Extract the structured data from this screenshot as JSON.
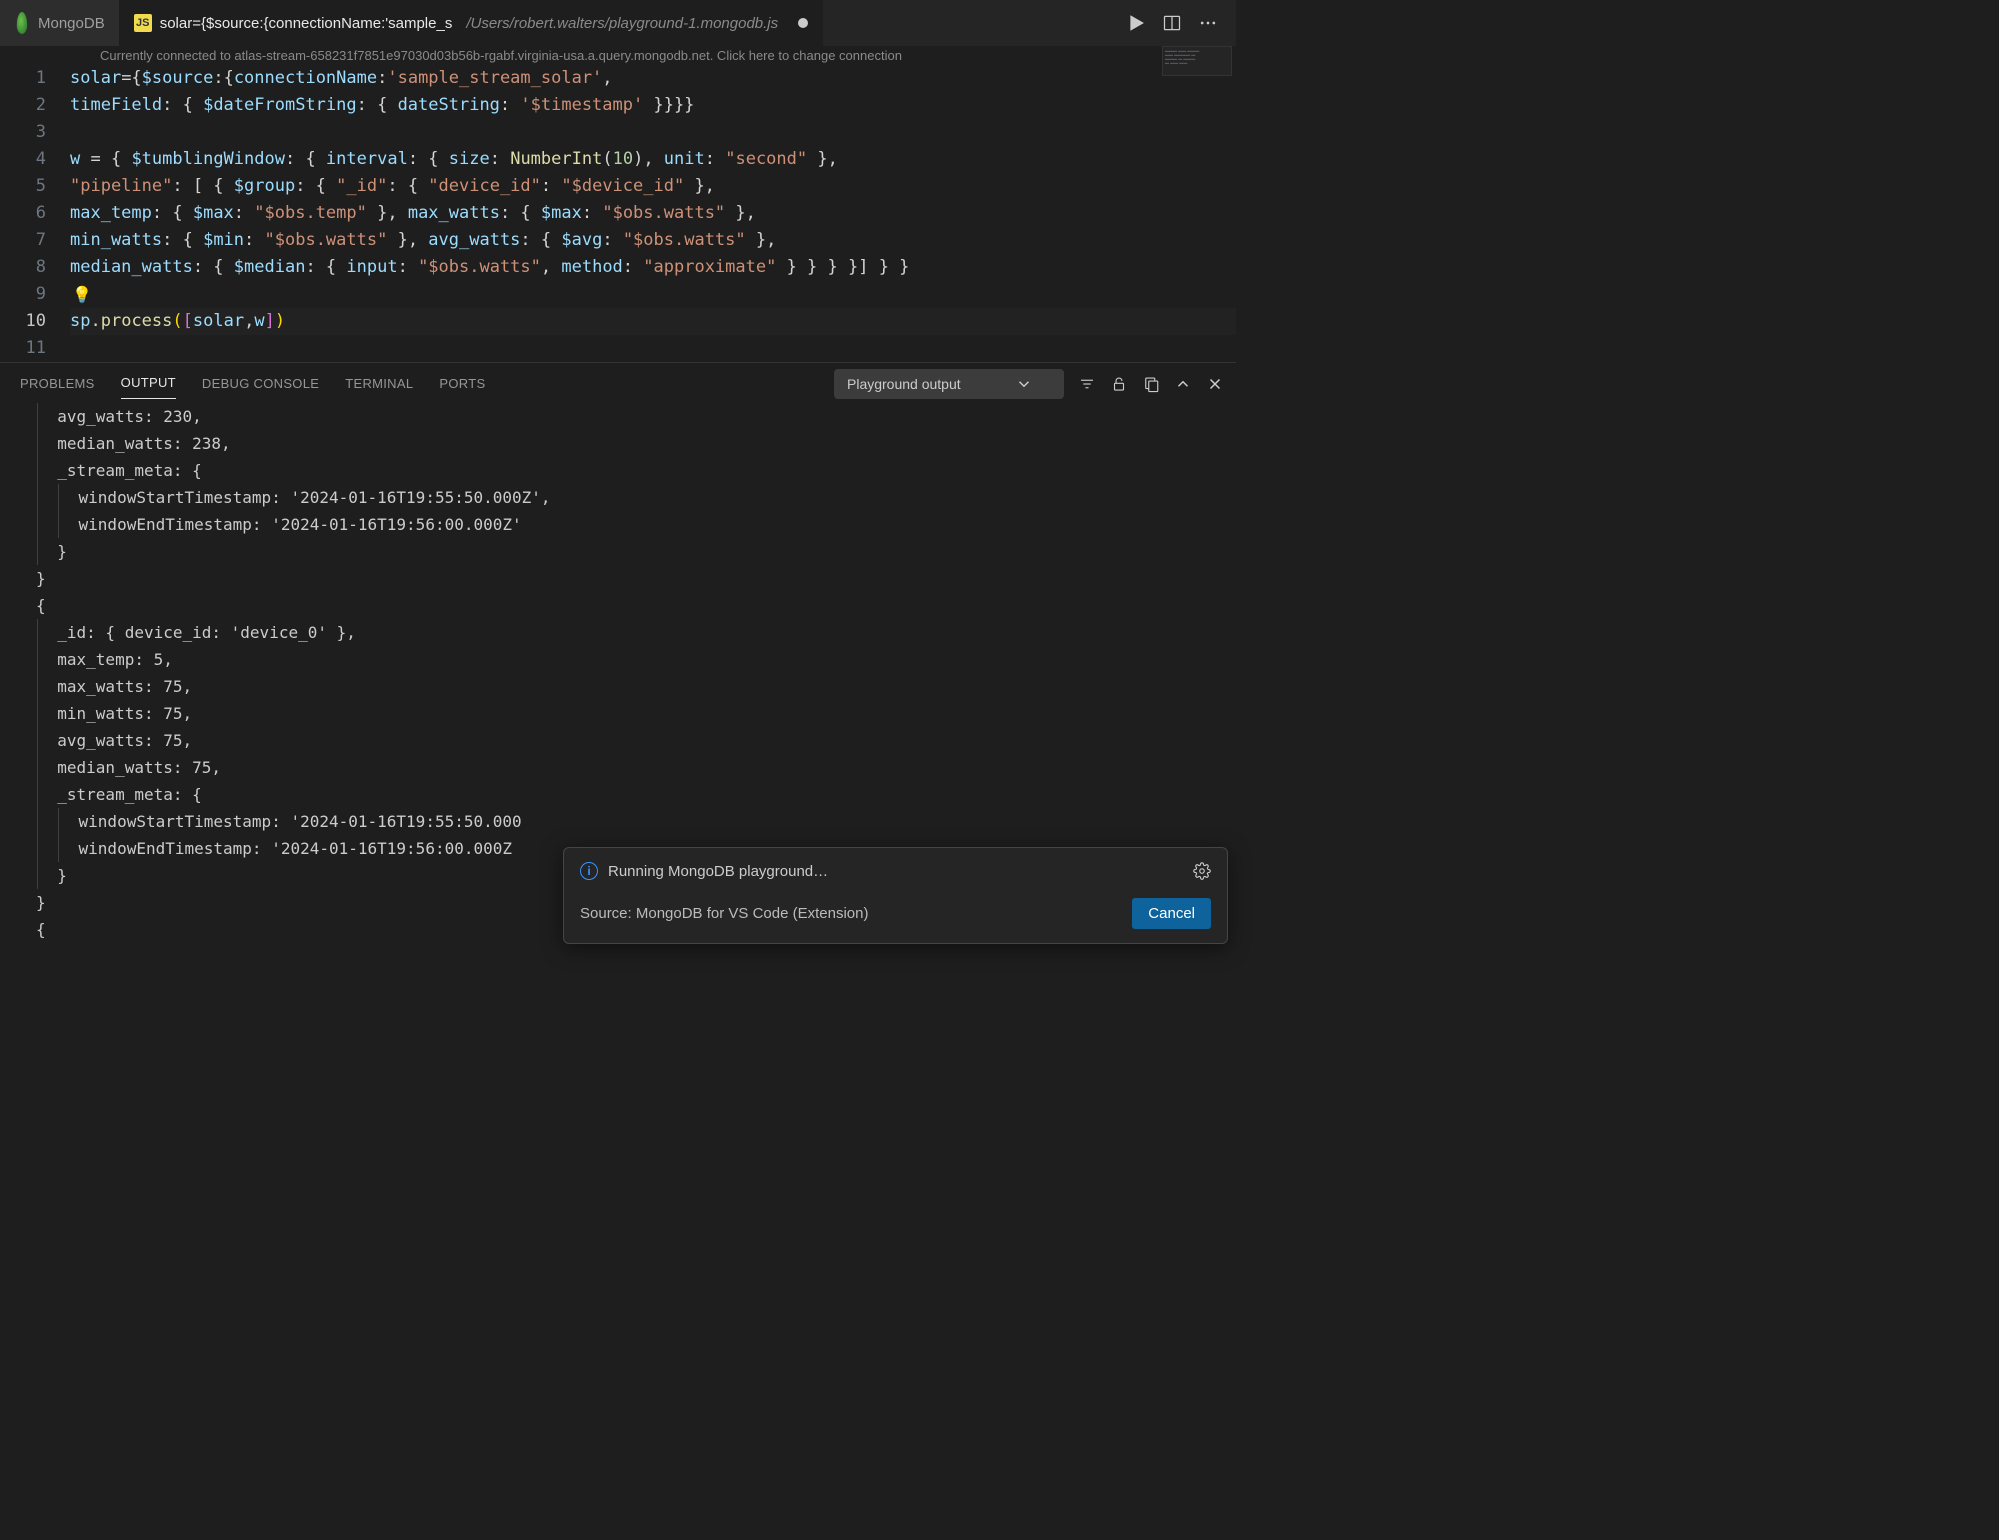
{
  "tabs": {
    "mongo_label": "MongoDB",
    "file_badge": "JS",
    "file_title": "solar={$source:{connectionName:'sample_s",
    "file_path": "/Users/robert.walters/playground-1.mongodb.js"
  },
  "connection_banner": "Currently connected to atlas-stream-658231f7851e97030d03b56b-rgabf.virginia-usa.a.query.mongodb.net. Click here to change connection",
  "editor": {
    "line_numbers": [
      "1",
      "2",
      "3",
      "4",
      "5",
      "6",
      "7",
      "8",
      "9",
      "10",
      "11"
    ],
    "lines": {
      "l1": {
        "pre": "solar",
        "mid": "={",
        "k1": "$source",
        "mid2": ":{",
        "k2": "connectionName",
        "mid3": ":",
        "s1": "'sample_stream_solar'",
        "end": ","
      },
      "l2": {
        "k1": "timeField",
        "mid": ": { ",
        "k2": "$dateFromString",
        "mid2": ": { ",
        "k3": "dateString",
        "mid3": ": ",
        "s1": "'$timestamp'",
        "end": " }}}}"
      },
      "l4": {
        "pre": "w ",
        "mid": "= { ",
        "k1": "$tumblingWindow",
        "mid2": ": { ",
        "k2": "interval",
        "mid3": ": { ",
        "k3": "size",
        "mid4": ": ",
        "fn": "NumberInt",
        "arg": "10",
        "mid5": ", ",
        "k4": "unit",
        "mid6": ": ",
        "s1": "\"second\"",
        "end": " },"
      },
      "l5": {
        "s0": "\"pipeline\"",
        "mid": ": [ { ",
        "k1": "$group",
        "mid2": ": { ",
        "s1": "\"_id\"",
        "mid3": ": { ",
        "s2": "\"device_id\"",
        "mid4": ": ",
        "s3": "\"$device_id\"",
        "end": " },"
      },
      "l6": {
        "k1": "max_temp",
        "mid": ": { ",
        "k2": "$max",
        "mid2": ": ",
        "s1": "\"$obs.temp\"",
        "mid3": " }, ",
        "k3": "max_watts",
        "mid4": ": { ",
        "k4": "$max",
        "mid5": ": ",
        "s2": "\"$obs.watts\"",
        "end": " },"
      },
      "l7": {
        "k1": "min_watts",
        "mid": ": { ",
        "k2": "$min",
        "mid2": ": ",
        "s1": "\"$obs.watts\"",
        "mid3": " }, ",
        "k3": "avg_watts",
        "mid4": ": { ",
        "k4": "$avg",
        "mid5": ": ",
        "s2": "\"$obs.watts\"",
        "end": " },"
      },
      "l8": {
        "k1": "median_watts",
        "mid": ": { ",
        "k2": "$median",
        "mid2": ": { ",
        "k3": "input",
        "mid3": ": ",
        "s1": "\"$obs.watts\"",
        "mid4": ", ",
        "k4": "method",
        "mid5": ": ",
        "s2": "\"approximate\"",
        "end": " } } } }] } }"
      },
      "l10": {
        "obj": "sp",
        "dot": ".",
        "fn": "process",
        "p1": "(",
        "b1": "[",
        "a1": "solar",
        "c": ",",
        "a2": "w",
        "b2": "]",
        "p2": ")"
      }
    }
  },
  "panel": {
    "tabs": {
      "problems": "PROBLEMS",
      "output": "OUTPUT",
      "debug": "DEBUG CONSOLE",
      "terminal": "TERMINAL",
      "ports": "PORTS"
    },
    "output_select": "Playground output"
  },
  "output_lines": [
    "  avg_watts: 230,",
    "  median_watts: 238,",
    "  _stream_meta: {",
    "    windowStartTimestamp: '2024-01-16T19:55:50.000Z',",
    "    windowEndTimestamp: '2024-01-16T19:56:00.000Z'",
    "  }",
    "}",
    "{",
    "  _id: { device_id: 'device_0' },",
    "  max_temp: 5,",
    "  max_watts: 75,",
    "  min_watts: 75,",
    "  avg_watts: 75,",
    "  median_watts: 75,",
    "  _stream_meta: {",
    "    windowStartTimestamp: '2024-01-16T19:55:50.000",
    "    windowEndTimestamp: '2024-01-16T19:56:00.000Z",
    "  }",
    "}",
    "{"
  ],
  "notification": {
    "title": "Running MongoDB playground…",
    "source_label": "Source: MongoDB for VS Code (Extension)",
    "cancel": "Cancel"
  }
}
